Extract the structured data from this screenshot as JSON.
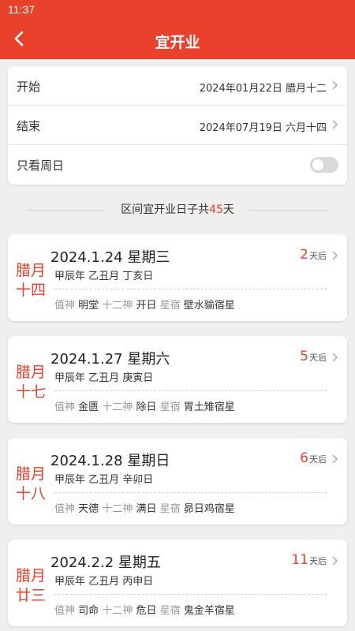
{
  "status": {
    "time": "11:37"
  },
  "header": {
    "title": "宜开业",
    "back_icon": "chevron-left-icon"
  },
  "colors": {
    "accent": "#e8412c",
    "background": "#f0efed"
  },
  "settings": {
    "start": {
      "label": "开始",
      "value": "2024年01月22日 腊月十二"
    },
    "end": {
      "label": "结束",
      "value": "2024年07月19日 六月十四"
    },
    "sunday_only": {
      "label": "只看周日",
      "enabled": false
    }
  },
  "summary": {
    "prefix": "区间宜开业日子共",
    "count": "45",
    "suffix": "天"
  },
  "cards": [
    {
      "lunar_1": "腊月",
      "lunar_2": "十四",
      "date": "2024.1.24 星期三",
      "ganzhi": "甲辰年 乙丑月 丁亥日",
      "zhishen_label": "值神",
      "zhishen": "明堂",
      "shier_label": "十二神",
      "shier": "开日",
      "xingxiu_label": "星宿",
      "xingxiu": "壁水貐宿星",
      "days_num": "2",
      "days_suffix": "天后"
    },
    {
      "lunar_1": "腊月",
      "lunar_2": "十七",
      "date": "2024.1.27 星期六",
      "ganzhi": "甲辰年 乙丑月 庚寅日",
      "zhishen_label": "值神",
      "zhishen": "金匮",
      "shier_label": "十二神",
      "shier": "除日",
      "xingxiu_label": "星宿",
      "xingxiu": "胃土雉宿星",
      "days_num": "5",
      "days_suffix": "天后"
    },
    {
      "lunar_1": "腊月",
      "lunar_2": "十八",
      "date": "2024.1.28 星期日",
      "ganzhi": "甲辰年 乙丑月 辛卯日",
      "zhishen_label": "值神",
      "zhishen": "天德",
      "shier_label": "十二神",
      "shier": "满日",
      "xingxiu_label": "星宿",
      "xingxiu": "昴日鸡宿星",
      "days_num": "6",
      "days_suffix": "天后"
    },
    {
      "lunar_1": "腊月",
      "lunar_2": "廿三",
      "date": "2024.2.2 星期五",
      "ganzhi": "甲辰年 乙丑月 丙申日",
      "zhishen_label": "值神",
      "zhishen": "司命",
      "shier_label": "十二神",
      "shier": "危日",
      "xingxiu_label": "星宿",
      "xingxiu": "鬼金羊宿星",
      "days_num": "11",
      "days_suffix": "天后"
    }
  ]
}
